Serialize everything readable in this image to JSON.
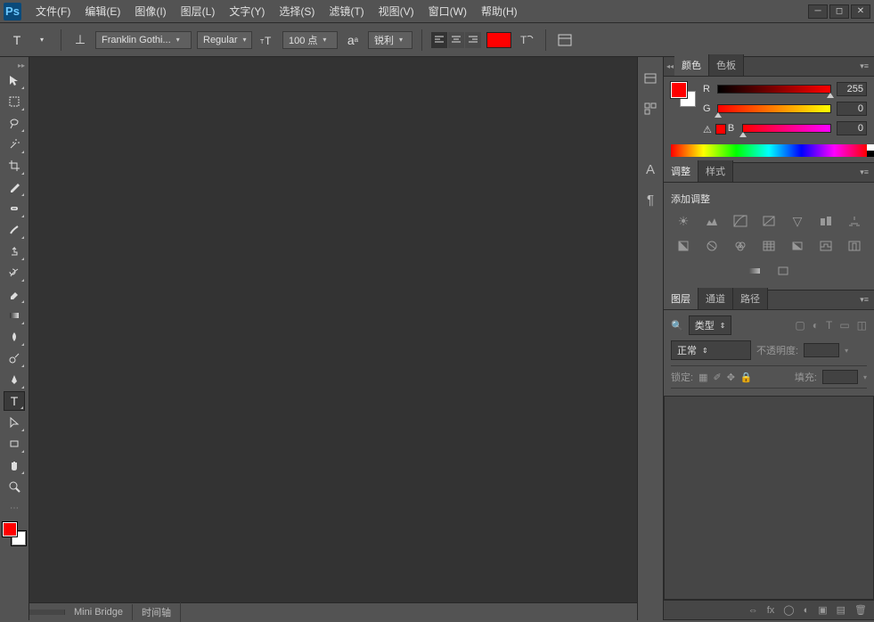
{
  "app": {
    "logo": "Ps"
  },
  "menu": [
    "文件(F)",
    "编辑(E)",
    "图像(I)",
    "图层(L)",
    "文字(Y)",
    "选择(S)",
    "滤镜(T)",
    "视图(V)",
    "窗口(W)",
    "帮助(H)"
  ],
  "options": {
    "font_family": "Franklin Gothi...",
    "font_style": "Regular",
    "font_size": "100 点",
    "antialias": "锐利",
    "text_color": "#ff0000"
  },
  "tools": {
    "fg_color": "#ff0000",
    "bg_color": "#ffffff"
  },
  "status": {
    "tab1": "Mini Bridge",
    "tab2": "时间轴"
  },
  "panels": {
    "color": {
      "tab_color": "颜色",
      "tab_swatches": "色板",
      "r_label": "R",
      "r_value": "255",
      "g_label": "G",
      "g_value": "0",
      "b_label": "B",
      "b_value": "0"
    },
    "adjustments": {
      "tab_adjust": "调整",
      "tab_styles": "样式",
      "title": "添加调整"
    },
    "layers": {
      "tab_layers": "图层",
      "tab_channels": "通道",
      "tab_paths": "路径",
      "filter_label": "类型",
      "blend_mode": "正常",
      "opacity_label": "不透明度:",
      "lock_label": "锁定:",
      "fill_label": "填充:"
    }
  }
}
